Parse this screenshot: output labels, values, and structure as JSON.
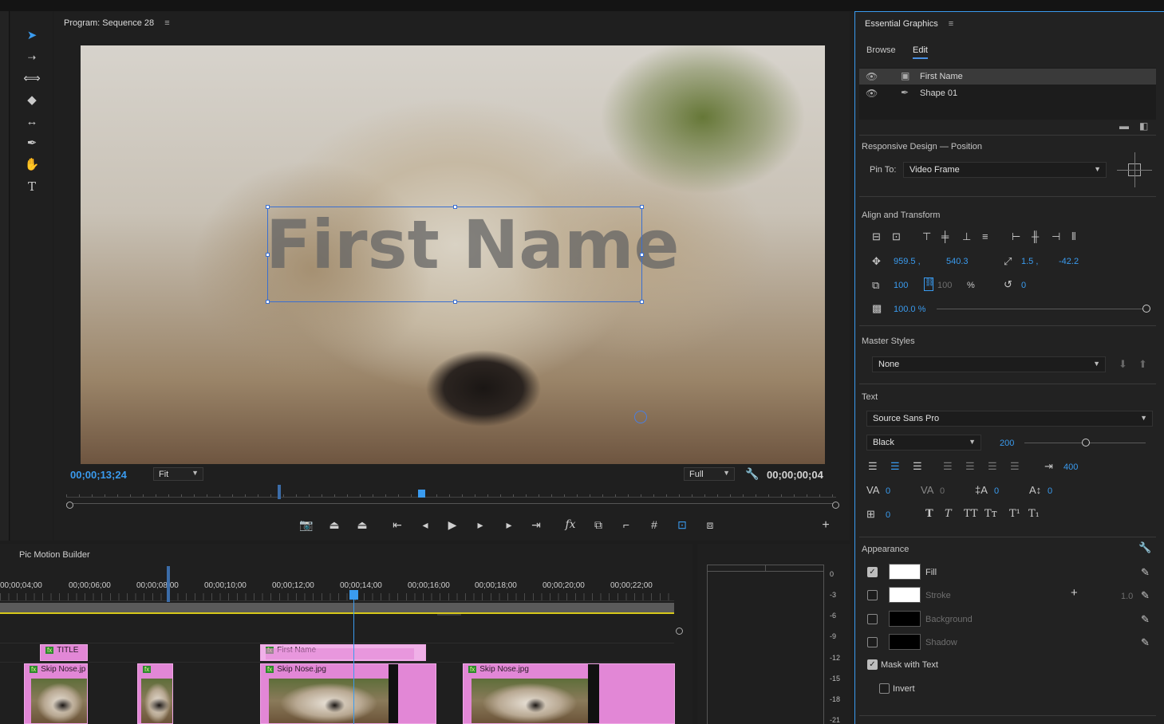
{
  "program": {
    "title": "Program: Sequence 28",
    "menu_icon": "hamburger-icon",
    "overlay_text": "First Name",
    "timecode_current": "00;00;13;24",
    "zoom": "Fit",
    "resolution": "Full",
    "timecode_duration": "00;00;00;04"
  },
  "tools": [
    "selection-tool-icon",
    "track-select-tool-icon",
    "ripple-edit-tool-icon",
    "razor-tool-icon",
    "slip-tool-icon",
    "pen-tool-icon",
    "hand-tool-icon",
    "type-tool-icon"
  ],
  "essential_graphics": {
    "title": "Essential Graphics",
    "tabs": {
      "browse": "Browse",
      "edit": "Edit"
    },
    "layers": [
      {
        "name": "First Name",
        "type": "text",
        "selected": true
      },
      {
        "name": "Shape 01",
        "type": "shape",
        "selected": false
      }
    ],
    "responsive": {
      "label": "Responsive Design — Position",
      "pin_label": "Pin To:",
      "pin_value": "Video Frame"
    },
    "align": {
      "label": "Align and Transform",
      "pos_x": "959.5 ,",
      "pos_y": "540.3",
      "anchor_x": "1.5 ,",
      "anchor_y": "-42.2",
      "scale": "100",
      "scale_linked": "100",
      "percent": "%",
      "rotation": "0",
      "opacity": "100.0 %"
    },
    "master": {
      "label": "Master Styles",
      "value": "None"
    },
    "text": {
      "label": "Text",
      "font": "Source Sans Pro",
      "style": "Black",
      "size": "200",
      "tab_width": "400",
      "kerning": "0",
      "tracking": "0",
      "leading": "0",
      "baseline": "0",
      "tsume": "0",
      "font_style_buttons": [
        "T",
        "T",
        "TT",
        "Tт",
        "T¹",
        "T₁"
      ]
    },
    "appearance": {
      "label": "Appearance",
      "fill": {
        "label": "Fill",
        "checked": true,
        "color": "#ffffff"
      },
      "stroke": {
        "label": "Stroke",
        "checked": false,
        "color": "#ffffff",
        "width": "1.0"
      },
      "background": {
        "label": "Background",
        "checked": false,
        "color": "#000000"
      },
      "shadow": {
        "label": "Shadow",
        "checked": false,
        "color": "#000000"
      },
      "mask": {
        "label": "Mask with Text",
        "checked": true
      },
      "invert": {
        "label": "Invert",
        "checked": false
      }
    }
  },
  "timeline": {
    "title": "Pic Motion Builder",
    "ticks": [
      "00;00;04;00",
      "00;00;06;00",
      "00;00;08;00",
      "00;00;10;00",
      "00;00;12;00",
      "00;00;14;00",
      "00;00;16;00",
      "00;00;18;00",
      "00;00;20;00",
      "00;00;22;00"
    ],
    "clips": {
      "title": "TITLE",
      "first_name": "First Name",
      "skip1": "Skip Nose.jp",
      "skip2": "Skip Nose.jpg",
      "skip3": "Skip Nose.jpg"
    }
  },
  "meters": {
    "db": [
      "0",
      "-3",
      "-6",
      "-9",
      "-12",
      "-15",
      "-18",
      "-21"
    ]
  },
  "colors": {
    "accent": "#3a9bef",
    "clip": "#e287d6",
    "audio_bar": "#d8c81a"
  }
}
